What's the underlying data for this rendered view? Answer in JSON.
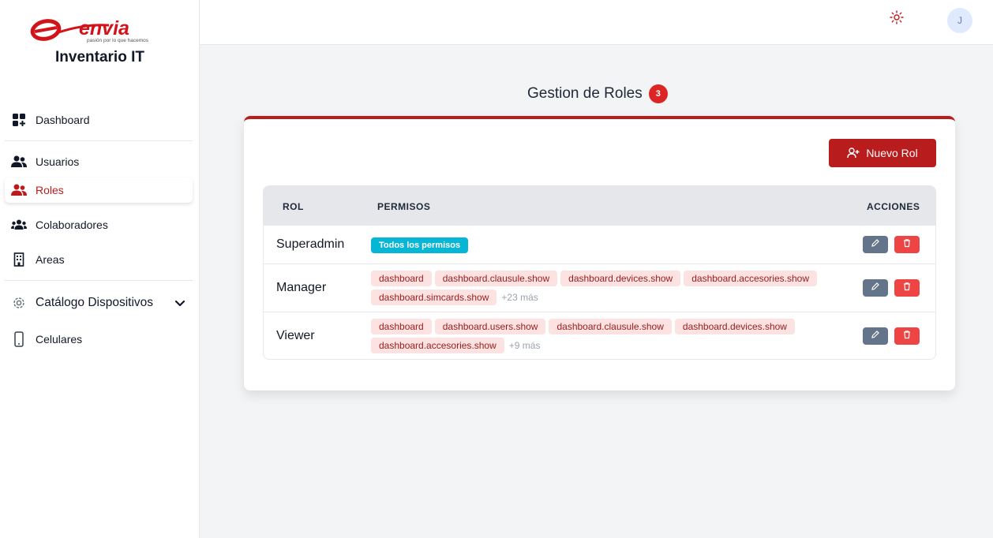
{
  "brand": {
    "logo_text": "envia",
    "logo_tagline": "pasión por lo que hacemos",
    "app_name": "Inventario IT",
    "color": "#d3131a"
  },
  "sidebar": {
    "items": [
      {
        "label": "Dashboard",
        "icon": "dashboard-icon"
      },
      {
        "label": "Usuarios",
        "icon": "users-icon"
      },
      {
        "label": "Roles",
        "icon": "roles-icon",
        "active": true
      },
      {
        "label": "Colaboradores",
        "icon": "collaborators-icon"
      },
      {
        "label": "Areas",
        "icon": "building-icon"
      },
      {
        "label": "Catálogo Dispositivos",
        "icon": "gear-icon"
      },
      {
        "label": "Celulares",
        "icon": "phone-icon"
      }
    ]
  },
  "header": {
    "avatar_initial": "J",
    "theme_icon": "sun-icon"
  },
  "main": {
    "title": "Gestion de Roles",
    "count": "3",
    "new_button": "Nuevo Rol",
    "table": {
      "headers": [
        "ROL",
        "PERMISOS",
        "ACCIONES"
      ],
      "rows": [
        {
          "role": "Superadmin",
          "all_permissions": "Todos los permisos",
          "permissions": [],
          "more": ""
        },
        {
          "role": "Manager",
          "permissions": [
            "dashboard",
            "dashboard.clausule.show",
            "dashboard.devices.show",
            "dashboard.accesories.show",
            "dashboard.simcards.show"
          ],
          "more": "+23 más"
        },
        {
          "role": "Viewer",
          "permissions": [
            "dashboard",
            "dashboard.users.show",
            "dashboard.clausule.show",
            "dashboard.devices.show",
            "dashboard.accesories.show"
          ],
          "more": "+9 más"
        }
      ]
    }
  },
  "colors": {
    "accent": "#b91c1c",
    "badge": "#dc2626",
    "tag_all": "#06b6d4",
    "edit": "#64748b",
    "delete": "#ef4444"
  }
}
